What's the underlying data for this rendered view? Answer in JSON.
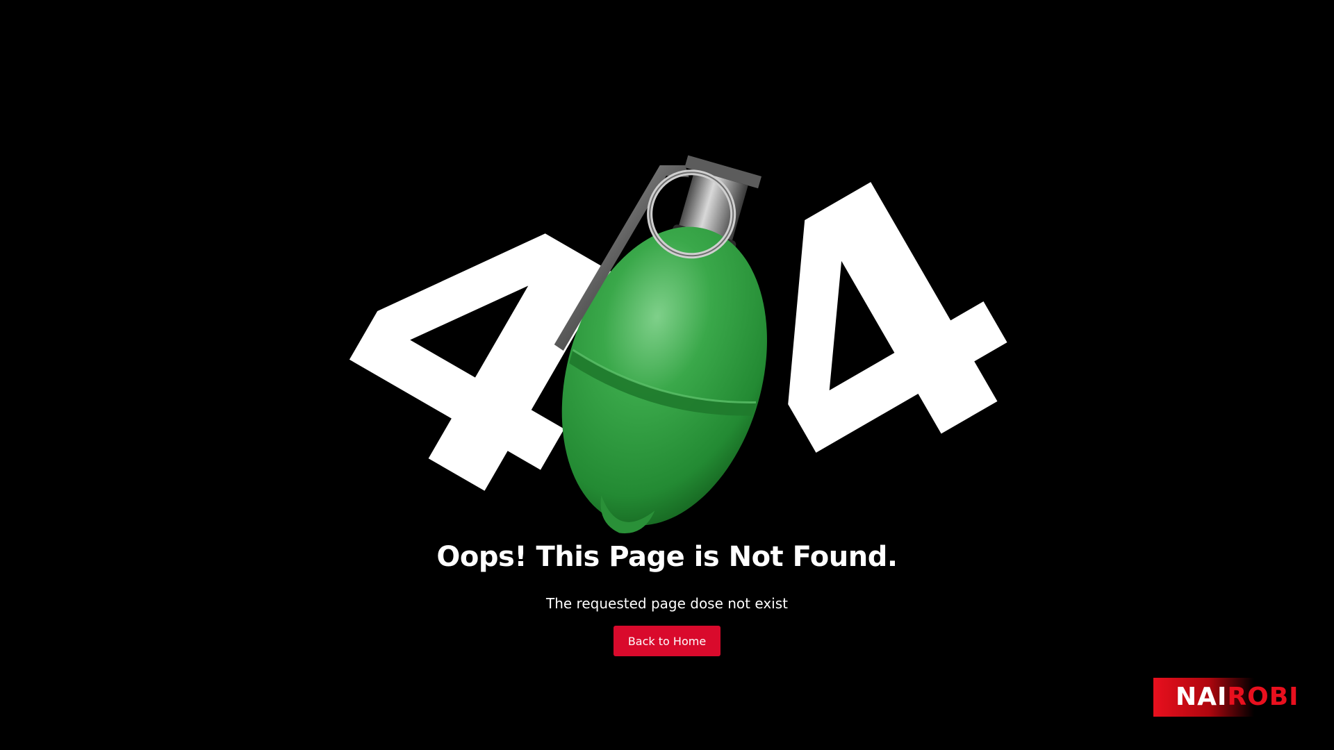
{
  "hero": {
    "digit_left": "4",
    "digit_right": "4",
    "center_icon": "grenade-icon",
    "grenade_color": "#2f9a3c"
  },
  "message": {
    "title": "Oops! This Page is Not Found.",
    "subtitle": "The requested page dose not exist"
  },
  "actions": {
    "home_label": "Back to Home",
    "home_color": "#d90a2c"
  },
  "brand": {
    "logo_part1": "NAI",
    "logo_part2": "ROBI",
    "accent": "#e8101e"
  },
  "colors": {
    "background": "#000000",
    "text": "#ffffff"
  }
}
